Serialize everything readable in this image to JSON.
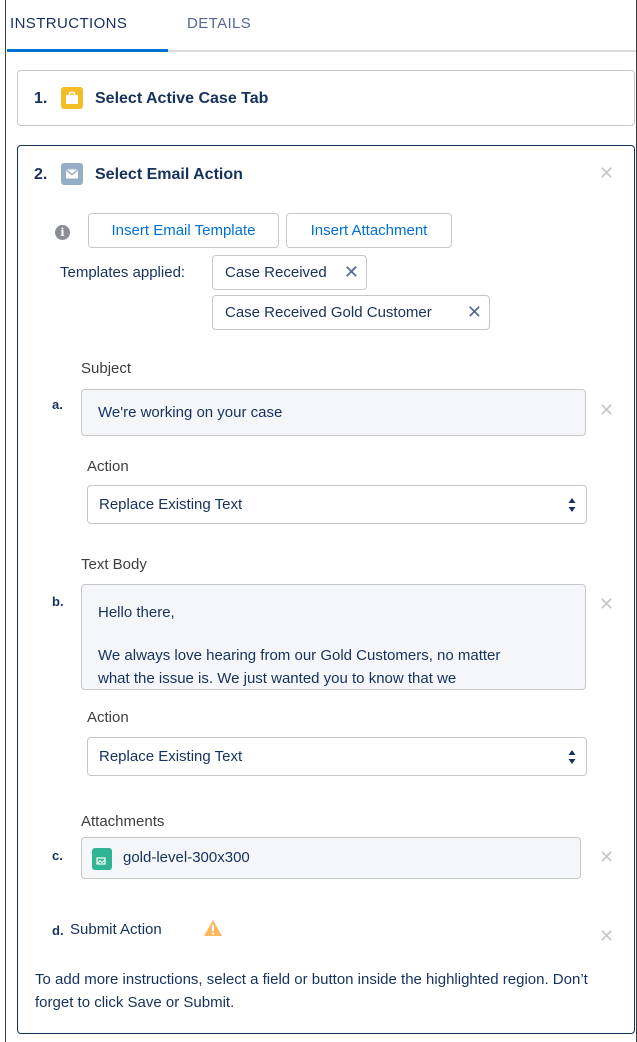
{
  "tabs": [
    {
      "label": "INSTRUCTIONS",
      "active": true
    },
    {
      "label": "DETAILS",
      "active": false
    }
  ],
  "steps": [
    {
      "number": "1.",
      "title": "Select Active Case Tab",
      "icon": "case-icon",
      "icon_color": "#f4bc25"
    },
    {
      "number": "2.",
      "title": "Select Email Action",
      "icon": "email-icon",
      "icon_color": "#95aec5"
    }
  ],
  "email_step": {
    "info_icon": "info-icon",
    "buttons": {
      "insert_template": "Insert Email Template",
      "insert_attachment": "Insert Attachment"
    },
    "templates_label": "Templates applied:",
    "templates": [
      "Case Received",
      "Case Received Gold Customer"
    ],
    "fields": {
      "subject": {
        "letter": "a.",
        "label": "Subject",
        "value": "We're working on your case",
        "action_label": "Action",
        "action_value": "Replace Existing Text"
      },
      "text_body": {
        "letter": "b.",
        "label": "Text Body",
        "line1": "Hello there,",
        "line2": "We always love hearing from our Gold Customers, no matter",
        "line3": "what the issue is. We just wanted you to know that we",
        "action_label": "Action",
        "action_value": "Replace Existing Text"
      },
      "attachments": {
        "letter": "c.",
        "label": "Attachments",
        "value": "gold-level-300x300",
        "icon": "image-file-icon",
        "icon_color": "#2fb594"
      },
      "submit": {
        "letter": "d.",
        "label": "Submit Action",
        "icon": "warning-icon",
        "icon_color": "#ffb75d"
      }
    },
    "footer": "To add more instructions, select a field or button inside the highlighted region. Don’t forget to click Save or Submit."
  },
  "colors": {
    "link": "#0070d2",
    "text": "#16325c",
    "border": "#c9c7c5",
    "readonly_bg": "#f4f6f9"
  }
}
